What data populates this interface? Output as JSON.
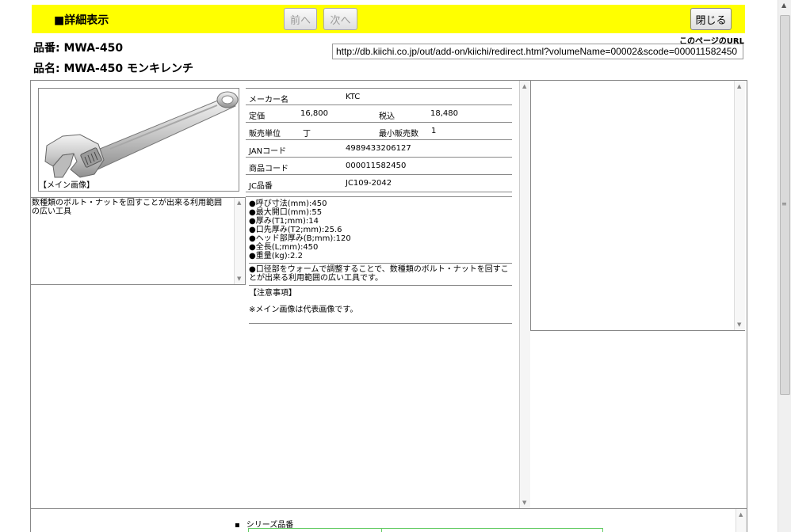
{
  "header": {
    "title": "■詳細表示",
    "prev_label": "前へ",
    "next_label": "次へ",
    "close_label": "閉じる"
  },
  "product": {
    "part_no": "品番: MWA-450",
    "part_name": "品名: MWA-450 モンキレンチ"
  },
  "page_url": {
    "label": "このページのURL",
    "value": "http://db.kiichi.co.jp/out/add-on/kiichi/redirect.html?volumeName=00002&scode=000011582450"
  },
  "photo": {
    "caption": "【メイン画像】"
  },
  "description": "数種類のボルト・ナットを回すことが出来る利用範囲の広い工具",
  "spec": {
    "maker_label": "メーカー名",
    "maker": "KTC",
    "list_price_label": "定価",
    "list_price": "16,800",
    "tax_incl_label": "税込",
    "tax_incl": "18,480",
    "unit_label": "販売単位",
    "unit": "丁",
    "min_qty_label": "最小販売数",
    "min_qty": "1",
    "jan_label": "JANコード",
    "jan": "4989433206127",
    "product_code_label": "商品コード",
    "product_code": "000011582450",
    "jc_label": "JC品番",
    "jc": "JC109-2042"
  },
  "features": {
    "items": [
      "●呼び寸法(mm):450",
      "●最大開口(mm):55",
      "●厚み(T1;mm):14",
      "●口先厚み(T2;mm):25.6",
      "●ヘッド部厚み(B;mm):120",
      "●全長(L;mm):450",
      "●重量(kg):2.2"
    ],
    "paragraph": "●口径部をウォームで調整することで、数種類のボルト・ナットを回すことが出来る利用範囲の広い工具です。",
    "notes_heading": "【注意事項】",
    "notes": "※メイン画像は代表画像です。"
  },
  "bottom": {
    "series_label": "シリーズ品番"
  }
}
